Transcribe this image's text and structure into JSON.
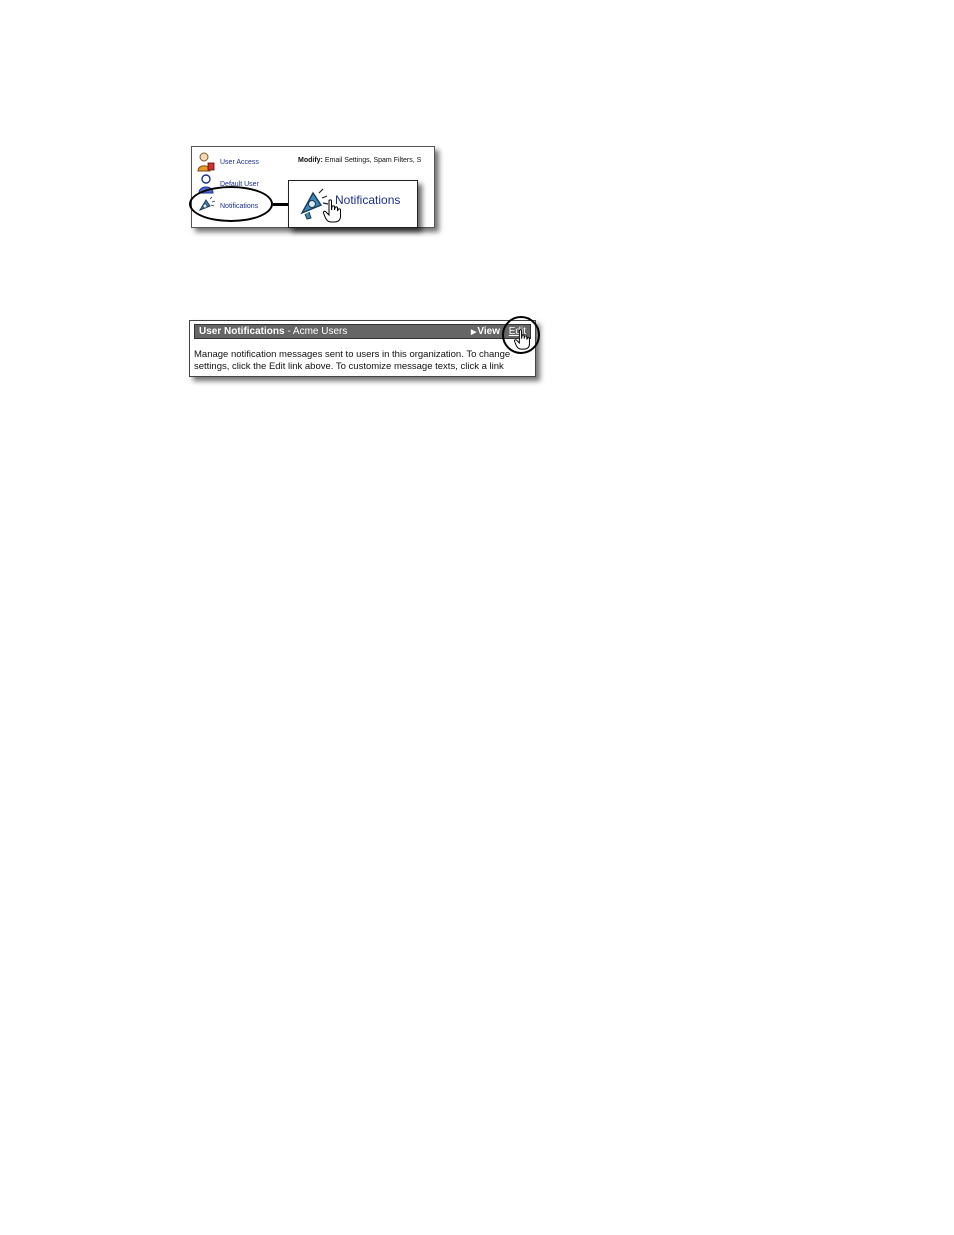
{
  "nav": {
    "items": [
      {
        "label": "User Access",
        "icon": "user-access-icon"
      },
      {
        "label": "Default User",
        "icon": "default-user-icon"
      },
      {
        "label": "Notifications",
        "icon": "megaphone-icon"
      }
    ]
  },
  "modify": {
    "label": "Modify:",
    "text": "Email Settings, Spam Filters, S"
  },
  "zoom": {
    "label": "Notifications",
    "icon": "megaphone-icon"
  },
  "panel": {
    "title": "User Notifications",
    "subtitle": "- Acme Users",
    "view_label": "View",
    "edit_label": "Edit",
    "description": "Manage notification messages sent to users in this organization. To change settings, click the Edit link above. To customize message texts, click a link"
  },
  "colors": {
    "link": "#1b2f8c",
    "titlebar": "#666666"
  }
}
